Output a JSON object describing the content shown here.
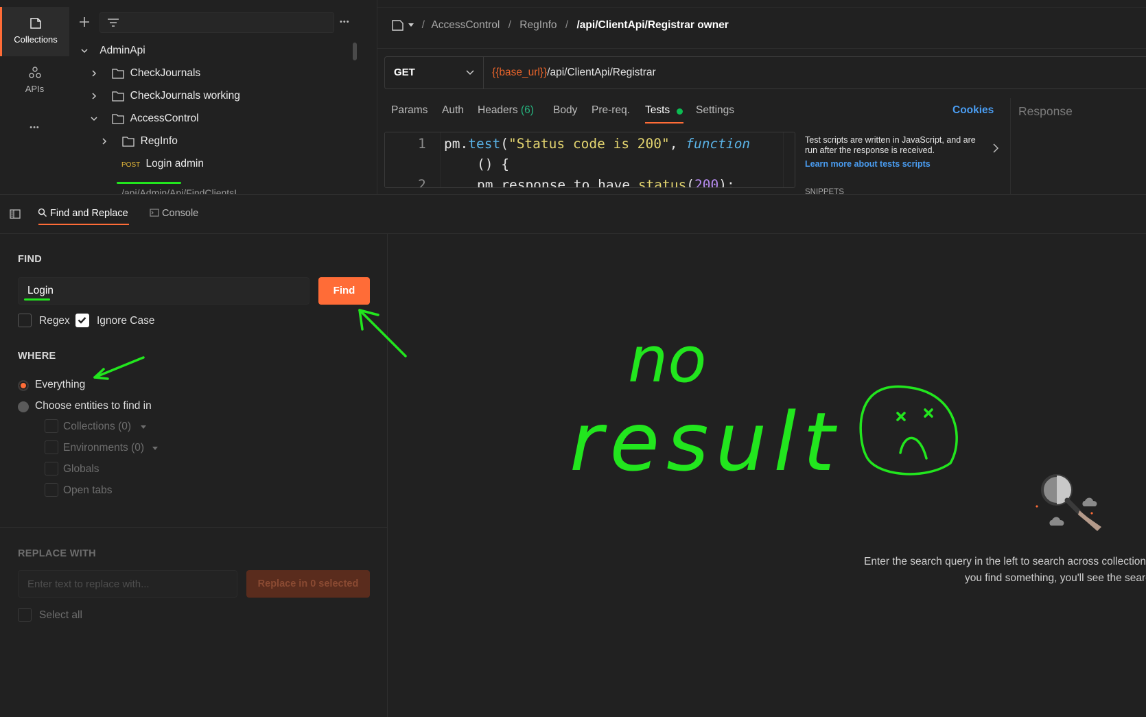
{
  "rail": {
    "collections_label": "Collections",
    "apis_label": "APIs",
    "more_label": "•••"
  },
  "sidebar": {
    "more_label": "•••",
    "tree": [
      {
        "label": "AdminApi",
        "expanded": true
      },
      {
        "label": "CheckJournals",
        "expanded": false
      },
      {
        "label": "CheckJournals working",
        "expanded": false
      },
      {
        "label": "AccessControl",
        "expanded": true
      },
      {
        "label": "RegInfo",
        "expanded": false
      },
      {
        "method": "POST",
        "label": "Login admin"
      },
      {
        "label": "/api/Admin/Api/FindClientsI..."
      }
    ]
  },
  "breadcrumb": {
    "items": [
      "AccessControl",
      "RegInfo"
    ],
    "current": "/api/ClientApi/Registrar owner",
    "separator": "/"
  },
  "request": {
    "method": "GET",
    "url_var": "{{base_url}}",
    "url_path": "/api/ClientApi/Registrar"
  },
  "tabs": {
    "items": [
      "Params",
      "Auth",
      "Headers",
      "Body",
      "Pre-req.",
      "Tests",
      "Settings"
    ],
    "headers_count": "(6)",
    "active": "Tests",
    "cookies": "Cookies",
    "response": "Response"
  },
  "code": {
    "line1_no": "1",
    "line2_no": "2",
    "l1_pm": "pm.",
    "l1_test": "test",
    "l1_paren": "(",
    "l1_str": "\"Status code is 200\"",
    "l1_comma": ", ",
    "l1_fn": "function",
    "l1b": "() {",
    "l2_a": "pm.response.to.have.",
    "l2_status": "status",
    "l2_paren": "(",
    "l2_num": "200",
    "l2_end": ");"
  },
  "help": {
    "text": "Test scripts are written in JavaScript, and are run after the response is received.",
    "link": "Learn more about tests scripts",
    "snippets": "SNIPPETS"
  },
  "panel_tabs": {
    "find_replace": "Find and Replace",
    "console": "Console"
  },
  "find": {
    "heading": "FIND",
    "value": "Login",
    "button": "Find",
    "regex_label": "Regex",
    "regex_checked": false,
    "ignore_case_label": "Ignore Case",
    "ignore_case_checked": true
  },
  "where": {
    "heading": "WHERE",
    "option_everything": "Everything",
    "option_choose": "Choose entities to find in",
    "selected": "Everything",
    "entities": [
      {
        "label": "Collections (0)",
        "dropdown": true
      },
      {
        "label": "Environments (0)",
        "dropdown": true
      },
      {
        "label": "Globals",
        "dropdown": false
      },
      {
        "label": "Open tabs",
        "dropdown": false
      }
    ]
  },
  "replace": {
    "heading": "REPLACE WITH",
    "placeholder": "Enter text to replace with...",
    "button": "Replace in 0 selected",
    "select_all": "Select all"
  },
  "empty_state": {
    "line1": "Enter the search query in the left to search across collections, e",
    "line2": "you find something, you'll see the search r"
  },
  "annotation": {
    "line1": "no",
    "line2": "result",
    "color": "#22e61e"
  },
  "colors": {
    "accent": "#ff6c37",
    "link": "#4a9df2",
    "tests_dot": "#0cbb52",
    "headers_count": "#26b47f",
    "url_var": "#e8642b"
  }
}
